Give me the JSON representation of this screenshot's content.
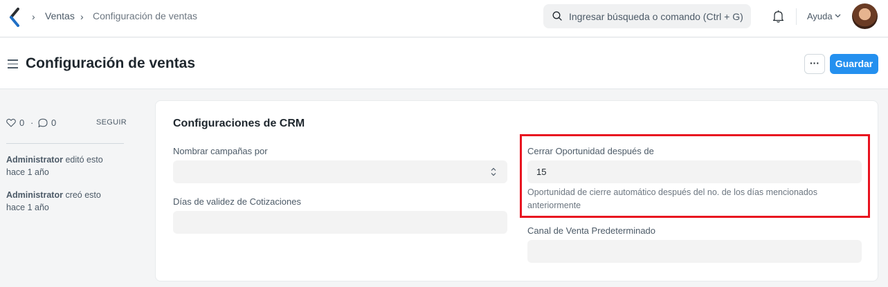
{
  "navbar": {
    "breadcrumbs": [
      "Ventas",
      "Configuración de ventas"
    ],
    "search_placeholder": "Ingresar búsqueda o comando (Ctrl + G)",
    "help_label": "Ayuda"
  },
  "page": {
    "title": "Configuración de ventas",
    "more_label": "···",
    "save_label": "Guardar"
  },
  "sidebar": {
    "likes": "0",
    "separator": "·",
    "comments": "0",
    "follow_label": "SEGUIR",
    "activity": [
      {
        "user": "Administrator",
        "action": "editó esto",
        "time": "hace 1 año"
      },
      {
        "user": "Administrator",
        "action": "creó esto",
        "time": "hace 1 año"
      }
    ]
  },
  "form": {
    "section_title": "Configuraciones de CRM",
    "fields": {
      "campaign_naming": {
        "label": "Nombrar campañas por",
        "value": ""
      },
      "quotation_validity": {
        "label": "Días de validez de Cotizaciones",
        "value": ""
      },
      "close_opportunity": {
        "label": "Cerrar Oportunidad después de",
        "value": "15",
        "description": "Oportunidad de cierre automático después del no. de los días mencionados anteriormente"
      },
      "default_sales_channel": {
        "label": "Canal de Venta Predeterminado",
        "value": ""
      }
    }
  },
  "colors": {
    "primary": "#2490ef",
    "highlight": "#e8121f",
    "logo": "#1f6fc5"
  }
}
